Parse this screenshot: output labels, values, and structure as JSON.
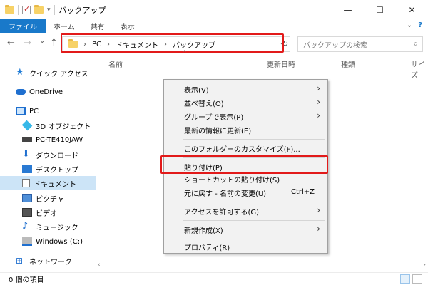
{
  "window": {
    "title": "バックアップ",
    "controls": {
      "minimize": "—",
      "maximize": "☐",
      "close": "✕"
    }
  },
  "ribbon": {
    "tabs": [
      {
        "label": "ファイル",
        "active": true
      },
      {
        "label": "ホーム"
      },
      {
        "label": "共有"
      },
      {
        "label": "表示"
      }
    ],
    "collapse_icon": "chevron-down-icon",
    "help_icon": "help-icon"
  },
  "navigation": {
    "back": "←",
    "forward": "→",
    "recent": "⌄",
    "up": "↑",
    "address": {
      "segments": [
        "PC",
        "ドキュメント",
        "バックアップ"
      ],
      "separator": "›"
    },
    "refresh": "↻",
    "search_placeholder": "バックアップの検索"
  },
  "sidebar": {
    "items": [
      {
        "label": "クイック アクセス",
        "icon": "star-icon"
      },
      {
        "label": "OneDrive",
        "icon": "cloud-icon"
      },
      {
        "label": "PC",
        "icon": "pc-icon"
      },
      {
        "label": "3D オブジェクト",
        "icon": "cube-icon"
      },
      {
        "label": "PC-TE410JAW",
        "icon": "drive-icon"
      },
      {
        "label": "ダウンロード",
        "icon": "download-icon"
      },
      {
        "label": "デスクトップ",
        "icon": "desktop-icon"
      },
      {
        "label": "ドキュメント",
        "icon": "document-icon",
        "selected": true
      },
      {
        "label": "ピクチャ",
        "icon": "pictures-icon"
      },
      {
        "label": "ビデオ",
        "icon": "video-icon"
      },
      {
        "label": "ミュージック",
        "icon": "music-icon"
      },
      {
        "label": "Windows (C:)",
        "icon": "windows-drive-icon"
      },
      {
        "label": "ネットワーク",
        "icon": "network-icon"
      }
    ]
  },
  "columns": [
    "名前",
    "更新日時",
    "種類",
    "サイズ"
  ],
  "context_menu": {
    "items": [
      {
        "label": "表示(V)",
        "submenu": true
      },
      {
        "label": "並べ替え(O)",
        "submenu": true
      },
      {
        "label": "グループで表示(P)",
        "submenu": true
      },
      {
        "label": "最新の情報に更新(E)"
      },
      {
        "label": "このフォルダーのカスタマイズ(F)..."
      },
      {
        "label": "貼り付け(P)",
        "highlighted": true
      },
      {
        "label": "ショートカットの貼り付け(S)"
      },
      {
        "label": "元に戻す - 名前の変更(U)",
        "shortcut": "Ctrl+Z"
      },
      {
        "label": "アクセスを許可する(G)",
        "submenu": true
      },
      {
        "label": "新規作成(X)",
        "submenu": true
      },
      {
        "label": "プロパティ(R)"
      }
    ]
  },
  "status": {
    "item_count": "0 個の項目"
  },
  "colors": {
    "accent": "#1979ca",
    "highlight_frame": "#e21a1a",
    "selection": "#cce4f7"
  }
}
